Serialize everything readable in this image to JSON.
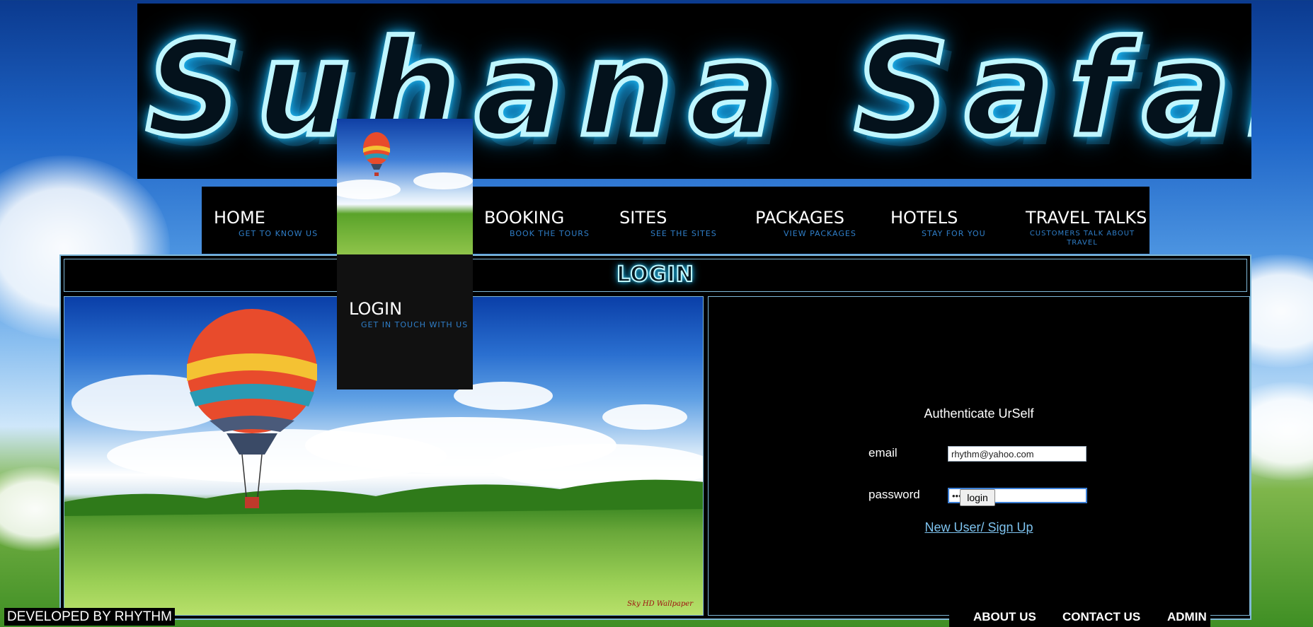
{
  "banner": {
    "title": "Suhana Safar"
  },
  "nav": {
    "items": [
      {
        "label": "HOME",
        "subtitle": "GET TO KNOW US"
      },
      {
        "label": "BOOKING",
        "subtitle": "BOOK THE TOURS"
      },
      {
        "label": "SITES",
        "subtitle": "SEE THE SITES"
      },
      {
        "label": "PACKAGES",
        "subtitle": "VIEW PACKAGES"
      },
      {
        "label": "HOTELS",
        "subtitle": "STAY FOR YOU"
      },
      {
        "label": "TRAVEL TALKS",
        "subtitle": "CUSTOMERS TALK ABOUT TRAVEL"
      }
    ],
    "dropdown": {
      "label": "LOGIN",
      "subtitle": "GET IN TOUCH WITH US"
    }
  },
  "content": {
    "heading": "LOGIN",
    "photo_watermark": "Sky HD Wallpaper"
  },
  "form": {
    "heading": "Authenticate UrSelf",
    "email_label": "email",
    "email_value": "rhythm@yahoo.com",
    "password_label": "password",
    "password_value": "•••",
    "login_button": "login",
    "signup_link": "New User/ Sign Up"
  },
  "footer": {
    "credit": "DEVELOPED BY RHYTHM",
    "links": [
      "ABOUT US",
      "CONTACT US",
      "ADMIN"
    ]
  },
  "colors": {
    "neon": "#2fd5ff",
    "nav_subtitle": "#2f7ec8",
    "frame_border": "#7fb8d8",
    "link": "#7ec3ef"
  }
}
